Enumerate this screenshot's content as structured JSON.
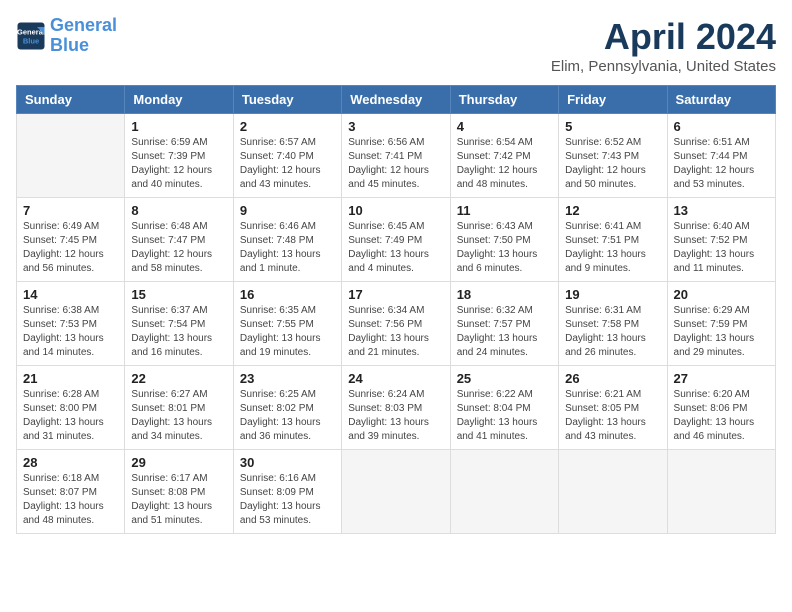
{
  "header": {
    "logo_line1": "General",
    "logo_line2": "Blue",
    "month": "April 2024",
    "location": "Elim, Pennsylvania, United States"
  },
  "days_of_week": [
    "Sunday",
    "Monday",
    "Tuesday",
    "Wednesday",
    "Thursday",
    "Friday",
    "Saturday"
  ],
  "weeks": [
    [
      {
        "day": "",
        "info": ""
      },
      {
        "day": "1",
        "info": "Sunrise: 6:59 AM\nSunset: 7:39 PM\nDaylight: 12 hours\nand 40 minutes."
      },
      {
        "day": "2",
        "info": "Sunrise: 6:57 AM\nSunset: 7:40 PM\nDaylight: 12 hours\nand 43 minutes."
      },
      {
        "day": "3",
        "info": "Sunrise: 6:56 AM\nSunset: 7:41 PM\nDaylight: 12 hours\nand 45 minutes."
      },
      {
        "day": "4",
        "info": "Sunrise: 6:54 AM\nSunset: 7:42 PM\nDaylight: 12 hours\nand 48 minutes."
      },
      {
        "day": "5",
        "info": "Sunrise: 6:52 AM\nSunset: 7:43 PM\nDaylight: 12 hours\nand 50 minutes."
      },
      {
        "day": "6",
        "info": "Sunrise: 6:51 AM\nSunset: 7:44 PM\nDaylight: 12 hours\nand 53 minutes."
      }
    ],
    [
      {
        "day": "7",
        "info": "Sunrise: 6:49 AM\nSunset: 7:45 PM\nDaylight: 12 hours\nand 56 minutes."
      },
      {
        "day": "8",
        "info": "Sunrise: 6:48 AM\nSunset: 7:47 PM\nDaylight: 12 hours\nand 58 minutes."
      },
      {
        "day": "9",
        "info": "Sunrise: 6:46 AM\nSunset: 7:48 PM\nDaylight: 13 hours\nand 1 minute."
      },
      {
        "day": "10",
        "info": "Sunrise: 6:45 AM\nSunset: 7:49 PM\nDaylight: 13 hours\nand 4 minutes."
      },
      {
        "day": "11",
        "info": "Sunrise: 6:43 AM\nSunset: 7:50 PM\nDaylight: 13 hours\nand 6 minutes."
      },
      {
        "day": "12",
        "info": "Sunrise: 6:41 AM\nSunset: 7:51 PM\nDaylight: 13 hours\nand 9 minutes."
      },
      {
        "day": "13",
        "info": "Sunrise: 6:40 AM\nSunset: 7:52 PM\nDaylight: 13 hours\nand 11 minutes."
      }
    ],
    [
      {
        "day": "14",
        "info": "Sunrise: 6:38 AM\nSunset: 7:53 PM\nDaylight: 13 hours\nand 14 minutes."
      },
      {
        "day": "15",
        "info": "Sunrise: 6:37 AM\nSunset: 7:54 PM\nDaylight: 13 hours\nand 16 minutes."
      },
      {
        "day": "16",
        "info": "Sunrise: 6:35 AM\nSunset: 7:55 PM\nDaylight: 13 hours\nand 19 minutes."
      },
      {
        "day": "17",
        "info": "Sunrise: 6:34 AM\nSunset: 7:56 PM\nDaylight: 13 hours\nand 21 minutes."
      },
      {
        "day": "18",
        "info": "Sunrise: 6:32 AM\nSunset: 7:57 PM\nDaylight: 13 hours\nand 24 minutes."
      },
      {
        "day": "19",
        "info": "Sunrise: 6:31 AM\nSunset: 7:58 PM\nDaylight: 13 hours\nand 26 minutes."
      },
      {
        "day": "20",
        "info": "Sunrise: 6:29 AM\nSunset: 7:59 PM\nDaylight: 13 hours\nand 29 minutes."
      }
    ],
    [
      {
        "day": "21",
        "info": "Sunrise: 6:28 AM\nSunset: 8:00 PM\nDaylight: 13 hours\nand 31 minutes."
      },
      {
        "day": "22",
        "info": "Sunrise: 6:27 AM\nSunset: 8:01 PM\nDaylight: 13 hours\nand 34 minutes."
      },
      {
        "day": "23",
        "info": "Sunrise: 6:25 AM\nSunset: 8:02 PM\nDaylight: 13 hours\nand 36 minutes."
      },
      {
        "day": "24",
        "info": "Sunrise: 6:24 AM\nSunset: 8:03 PM\nDaylight: 13 hours\nand 39 minutes."
      },
      {
        "day": "25",
        "info": "Sunrise: 6:22 AM\nSunset: 8:04 PM\nDaylight: 13 hours\nand 41 minutes."
      },
      {
        "day": "26",
        "info": "Sunrise: 6:21 AM\nSunset: 8:05 PM\nDaylight: 13 hours\nand 43 minutes."
      },
      {
        "day": "27",
        "info": "Sunrise: 6:20 AM\nSunset: 8:06 PM\nDaylight: 13 hours\nand 46 minutes."
      }
    ],
    [
      {
        "day": "28",
        "info": "Sunrise: 6:18 AM\nSunset: 8:07 PM\nDaylight: 13 hours\nand 48 minutes."
      },
      {
        "day": "29",
        "info": "Sunrise: 6:17 AM\nSunset: 8:08 PM\nDaylight: 13 hours\nand 51 minutes."
      },
      {
        "day": "30",
        "info": "Sunrise: 6:16 AM\nSunset: 8:09 PM\nDaylight: 13 hours\nand 53 minutes."
      },
      {
        "day": "",
        "info": ""
      },
      {
        "day": "",
        "info": ""
      },
      {
        "day": "",
        "info": ""
      },
      {
        "day": "",
        "info": ""
      }
    ]
  ]
}
